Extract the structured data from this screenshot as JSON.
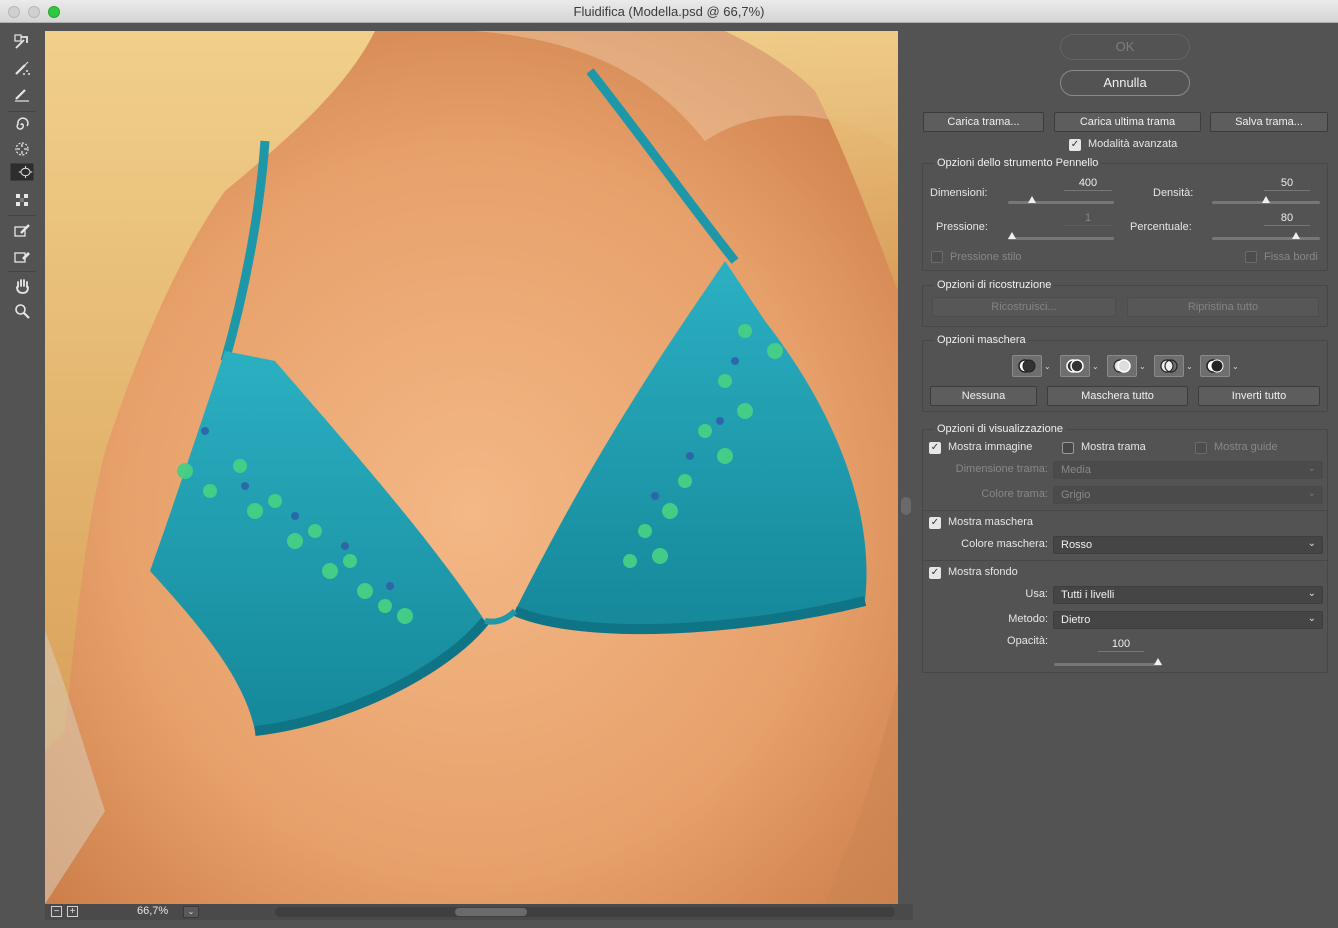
{
  "window": {
    "title": "Fluidifica (Modella.psd @ 66,7%)"
  },
  "toolbar": {
    "tools": [
      "forward-warp-tool-icon",
      "reconstruct-tool-icon",
      "smooth-tool-icon",
      "twirl-clockwise-tool-icon",
      "pucker-tool-icon",
      "bloat-tool-icon",
      "push-left-tool-icon",
      "freeze-mask-tool-icon",
      "thaw-mask-tool-icon",
      "hand-tool-icon",
      "zoom-tool-icon"
    ],
    "selected": "bloat-tool-icon"
  },
  "status": {
    "zoom": "66,7%"
  },
  "buttons": {
    "ok": "OK",
    "cancel": "Annulla",
    "load_mesh": "Carica trama...",
    "load_last_mesh": "Carica ultima trama",
    "save_mesh": "Salva trama...",
    "advanced_mode": "Modalità avanzata",
    "advanced_mode_checked": true
  },
  "brush_options": {
    "title": "Opzioni dello strumento Pennello",
    "size_label": "Dimensioni:",
    "size_value": "400",
    "size_level": 0.2,
    "density_label": "Densità:",
    "density_value": "50",
    "density_level": 0.5,
    "pressure_label": "Pressione:",
    "pressure_value": "1",
    "pressure_level": 0.0,
    "rate_label": "Percentuale:",
    "rate_value": "80",
    "rate_level": 0.8,
    "stylus_pressure": "Pressione stilo",
    "pin_edges": "Fissa bordi"
  },
  "reconstruct_options": {
    "title": "Opzioni di ricostruzione",
    "reconstruct": "Ricostruisci...",
    "restore_all": "Ripristina tutto"
  },
  "mask_options": {
    "title": "Opzioni maschera",
    "none": "Nessuna",
    "mask_all": "Maschera tutto",
    "invert_all": "Inverti tutto"
  },
  "view_options": {
    "title": "Opzioni di visualizzazione",
    "show_image": "Mostra immagine",
    "show_image_checked": true,
    "show_mesh": "Mostra trama",
    "show_mesh_checked": false,
    "show_guides": "Mostra guide",
    "mesh_size_label": "Dimensione trama:",
    "mesh_size_value": "Media",
    "mesh_color_label": "Colore trama:",
    "mesh_color_value": "Grigio",
    "show_mask": "Mostra maschera",
    "show_mask_checked": true,
    "mask_color_label": "Colore maschera:",
    "mask_color_value": "Rosso",
    "show_backdrop": "Mostra sfondo",
    "show_backdrop_checked": true,
    "use_label": "Usa:",
    "use_value": "Tutti i livelli",
    "mode_label": "Metodo:",
    "mode_value": "Dietro",
    "opacity_label": "Opacità:",
    "opacity_value": "100",
    "opacity_level": 1.0
  },
  "colors": {
    "panel_bg": "#535353",
    "swimsuit": "#1e97a8",
    "skin": "#e9a56e",
    "gems": "#3fcf7a"
  }
}
